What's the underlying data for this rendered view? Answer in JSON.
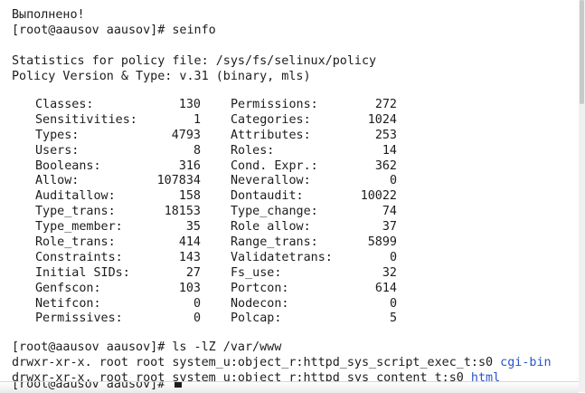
{
  "terminal": {
    "line_done": "Выполнено!",
    "prompt1": "[root@aausov aausov]# seinfo",
    "stats_title": "Statistics for policy file: /sys/fs/selinux/policy",
    "policy_version": "Policy Version & Type: v.31 (binary, mls)",
    "stats": [
      {
        "left_name": "Classes:",
        "left_value": "130",
        "right_name": "Permissions:",
        "right_value": "272"
      },
      {
        "left_name": "Sensitivities:",
        "left_value": "1",
        "right_name": "Categories:",
        "right_value": "1024"
      },
      {
        "left_name": "Types:",
        "left_value": "4793",
        "right_name": "Attributes:",
        "right_value": "253"
      },
      {
        "left_name": "Users:",
        "left_value": "8",
        "right_name": "Roles:",
        "right_value": "14"
      },
      {
        "left_name": "Booleans:",
        "left_value": "316",
        "right_name": "Cond. Expr.:",
        "right_value": "362"
      },
      {
        "left_name": "Allow:",
        "left_value": "107834",
        "right_name": "Neverallow:",
        "right_value": "0"
      },
      {
        "left_name": "Auditallow:",
        "left_value": "158",
        "right_name": "Dontaudit:",
        "right_value": "10022"
      },
      {
        "left_name": "Type_trans:",
        "left_value": "18153",
        "right_name": "Type_change:",
        "right_value": "74"
      },
      {
        "left_name": "Type_member:",
        "left_value": "35",
        "right_name": "Role allow:",
        "right_value": "37"
      },
      {
        "left_name": "Role_trans:",
        "left_value": "414",
        "right_name": "Range_trans:",
        "right_value": "5899"
      },
      {
        "left_name": "Constraints:",
        "left_value": "143",
        "right_name": "Validatetrans:",
        "right_value": "0"
      },
      {
        "left_name": "Initial SIDs:",
        "left_value": "27",
        "right_name": "Fs_use:",
        "right_value": "32"
      },
      {
        "left_name": "Genfscon:",
        "left_value": "103",
        "right_name": "Portcon:",
        "right_value": "614"
      },
      {
        "left_name": "Netifcon:",
        "left_value": "0",
        "right_name": "Nodecon:",
        "right_value": "0"
      },
      {
        "left_name": "Permissives:",
        "left_value": "0",
        "right_name": "Polcap:",
        "right_value": "5"
      }
    ],
    "prompt2": "[root@aausov aausov]# ls -lZ /var/www",
    "ls_lines": [
      {
        "text": "drwxr-xr-x. root root system_u:object_r:httpd_sys_script_exec_t:s0 ",
        "name": "cgi-bin"
      },
      {
        "text": "drwxr-xr-x. root root system_u:object_r:httpd_sys_content_t:s0 ",
        "name": "html"
      }
    ],
    "prompt3": "[root@aausov aausov]# ",
    "link_color": "#2a54c8"
  }
}
